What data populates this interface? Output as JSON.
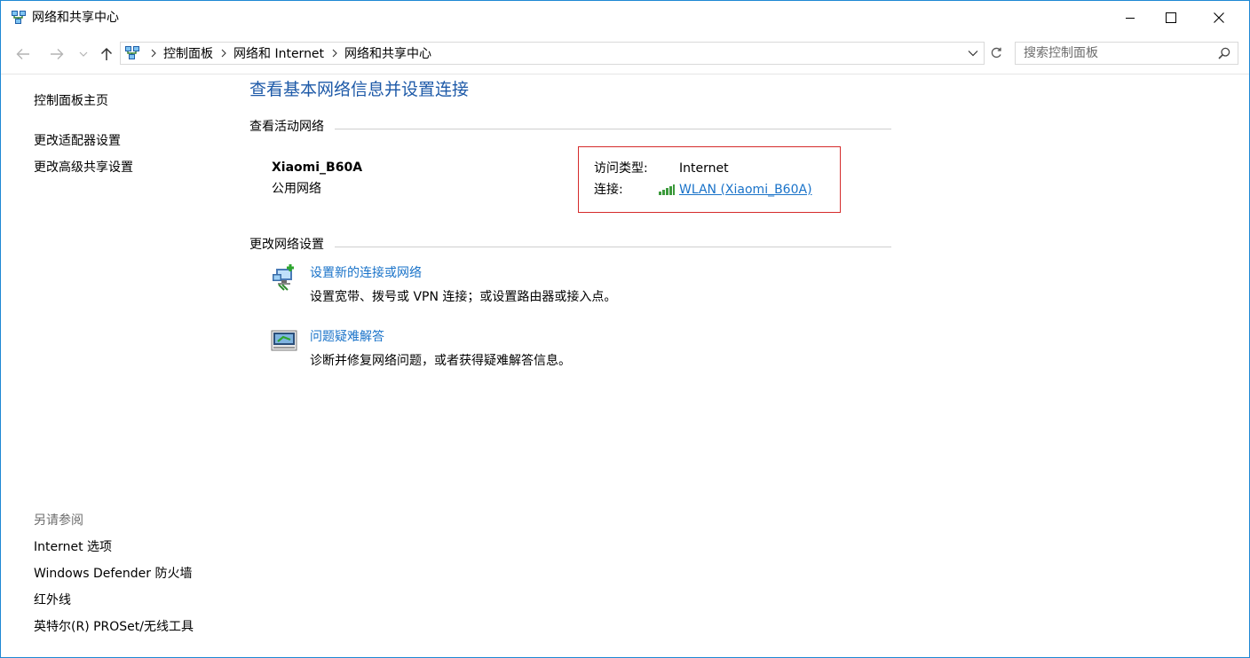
{
  "window": {
    "title": "网络和共享中心"
  },
  "address": {
    "crumbs": [
      "控制面板",
      "网络和 Internet",
      "网络和共享中心"
    ],
    "search_placeholder": "搜索控制面板"
  },
  "leftnav": {
    "home": "控制面板主页",
    "adapter": "更改适配器设置",
    "advanced_sharing": "更改高级共享设置",
    "see_also_title": "另请参阅",
    "see_also": [
      "Internet 选项",
      "Windows Defender 防火墙",
      "红外线",
      "英特尔(R) PROSet/无线工具"
    ]
  },
  "main": {
    "title": "查看基本网络信息并设置连接",
    "active_section": "查看活动网络",
    "network_name": "Xiaomi_B60A",
    "network_category": "公用网络",
    "access_type_label": "访问类型:",
    "access_type_value": "Internet",
    "connection_label": "连接:",
    "connection_value": "WLAN (Xiaomi_B60A)",
    "change_section": "更改网络设置",
    "tasks": [
      {
        "link": "设置新的连接或网络",
        "desc": "设置宽带、拨号或 VPN 连接；或设置路由器或接入点。"
      },
      {
        "link": "问题疑难解答",
        "desc": "诊断并修复网络问题，或者获得疑难解答信息。"
      }
    ]
  },
  "colors": {
    "accent_link": "#1a73c9",
    "title_blue": "#1e5aa8",
    "highlight_red": "#d52b2b",
    "window_border": "#1e88d4"
  },
  "icons": {
    "title": "network-center-icon",
    "signal": "wifi-signal-icon",
    "task1": "network-setup-icon",
    "task2": "troubleshoot-icon"
  }
}
